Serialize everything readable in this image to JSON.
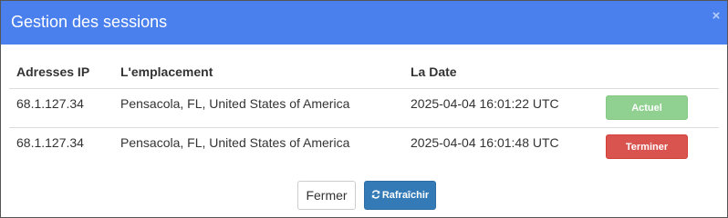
{
  "dialog": {
    "title": "Gestion des sessions",
    "close_glyph": "×"
  },
  "table": {
    "headers": [
      "Adresses IP",
      "L'emplacement",
      "La Date"
    ],
    "rows": [
      {
        "ip": "68.1.127.34",
        "location": "Pensacola, FL, United States of America",
        "date": "2025-04-04 16:01:22 UTC",
        "action_label": "Actuel",
        "action_type": "current"
      },
      {
        "ip": "68.1.127.34",
        "location": "Pensacola, FL, United States of America",
        "date": "2025-04-04 16:01:48 UTC",
        "action_label": "Terminer",
        "action_type": "terminate"
      }
    ]
  },
  "footer": {
    "close_label": "Fermer",
    "refresh_label": "Rafraîchir",
    "refresh_icon": "refresh-icon"
  },
  "colors": {
    "header_bg": "#4a80ee",
    "current_btn": "#90d090",
    "terminate_btn": "#d9534f",
    "refresh_btn": "#337ab7"
  }
}
